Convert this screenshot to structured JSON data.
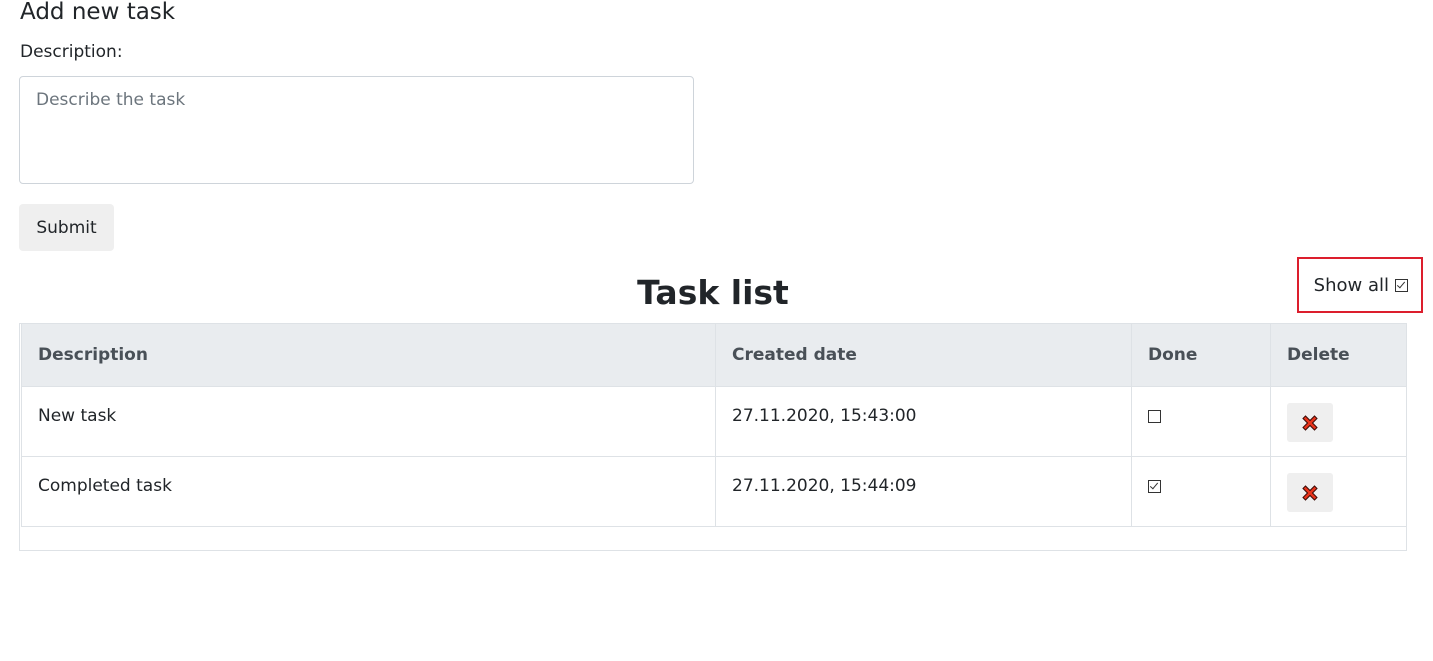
{
  "form": {
    "title": "Add new task",
    "description_label": "Description:",
    "description_value": "",
    "description_placeholder": "Describe the task",
    "submit_label": "Submit"
  },
  "task_list": {
    "title": "Task list",
    "show_all_label": "Show all",
    "show_all_checked": true,
    "columns": {
      "description": "Description",
      "created_date": "Created date",
      "done": "Done",
      "delete": "Delete"
    },
    "rows": [
      {
        "description": "New task",
        "created_date": "27.11.2020, 15:43:00",
        "done": false
      },
      {
        "description": "Completed task",
        "created_date": "27.11.2020, 15:44:09",
        "done": true
      }
    ]
  },
  "colors": {
    "highlight_border": "#dc1e2d",
    "delete_icon": "#e8341c",
    "header_bg": "#e9ecef"
  },
  "icons": {
    "delete": "red-x-icon"
  }
}
